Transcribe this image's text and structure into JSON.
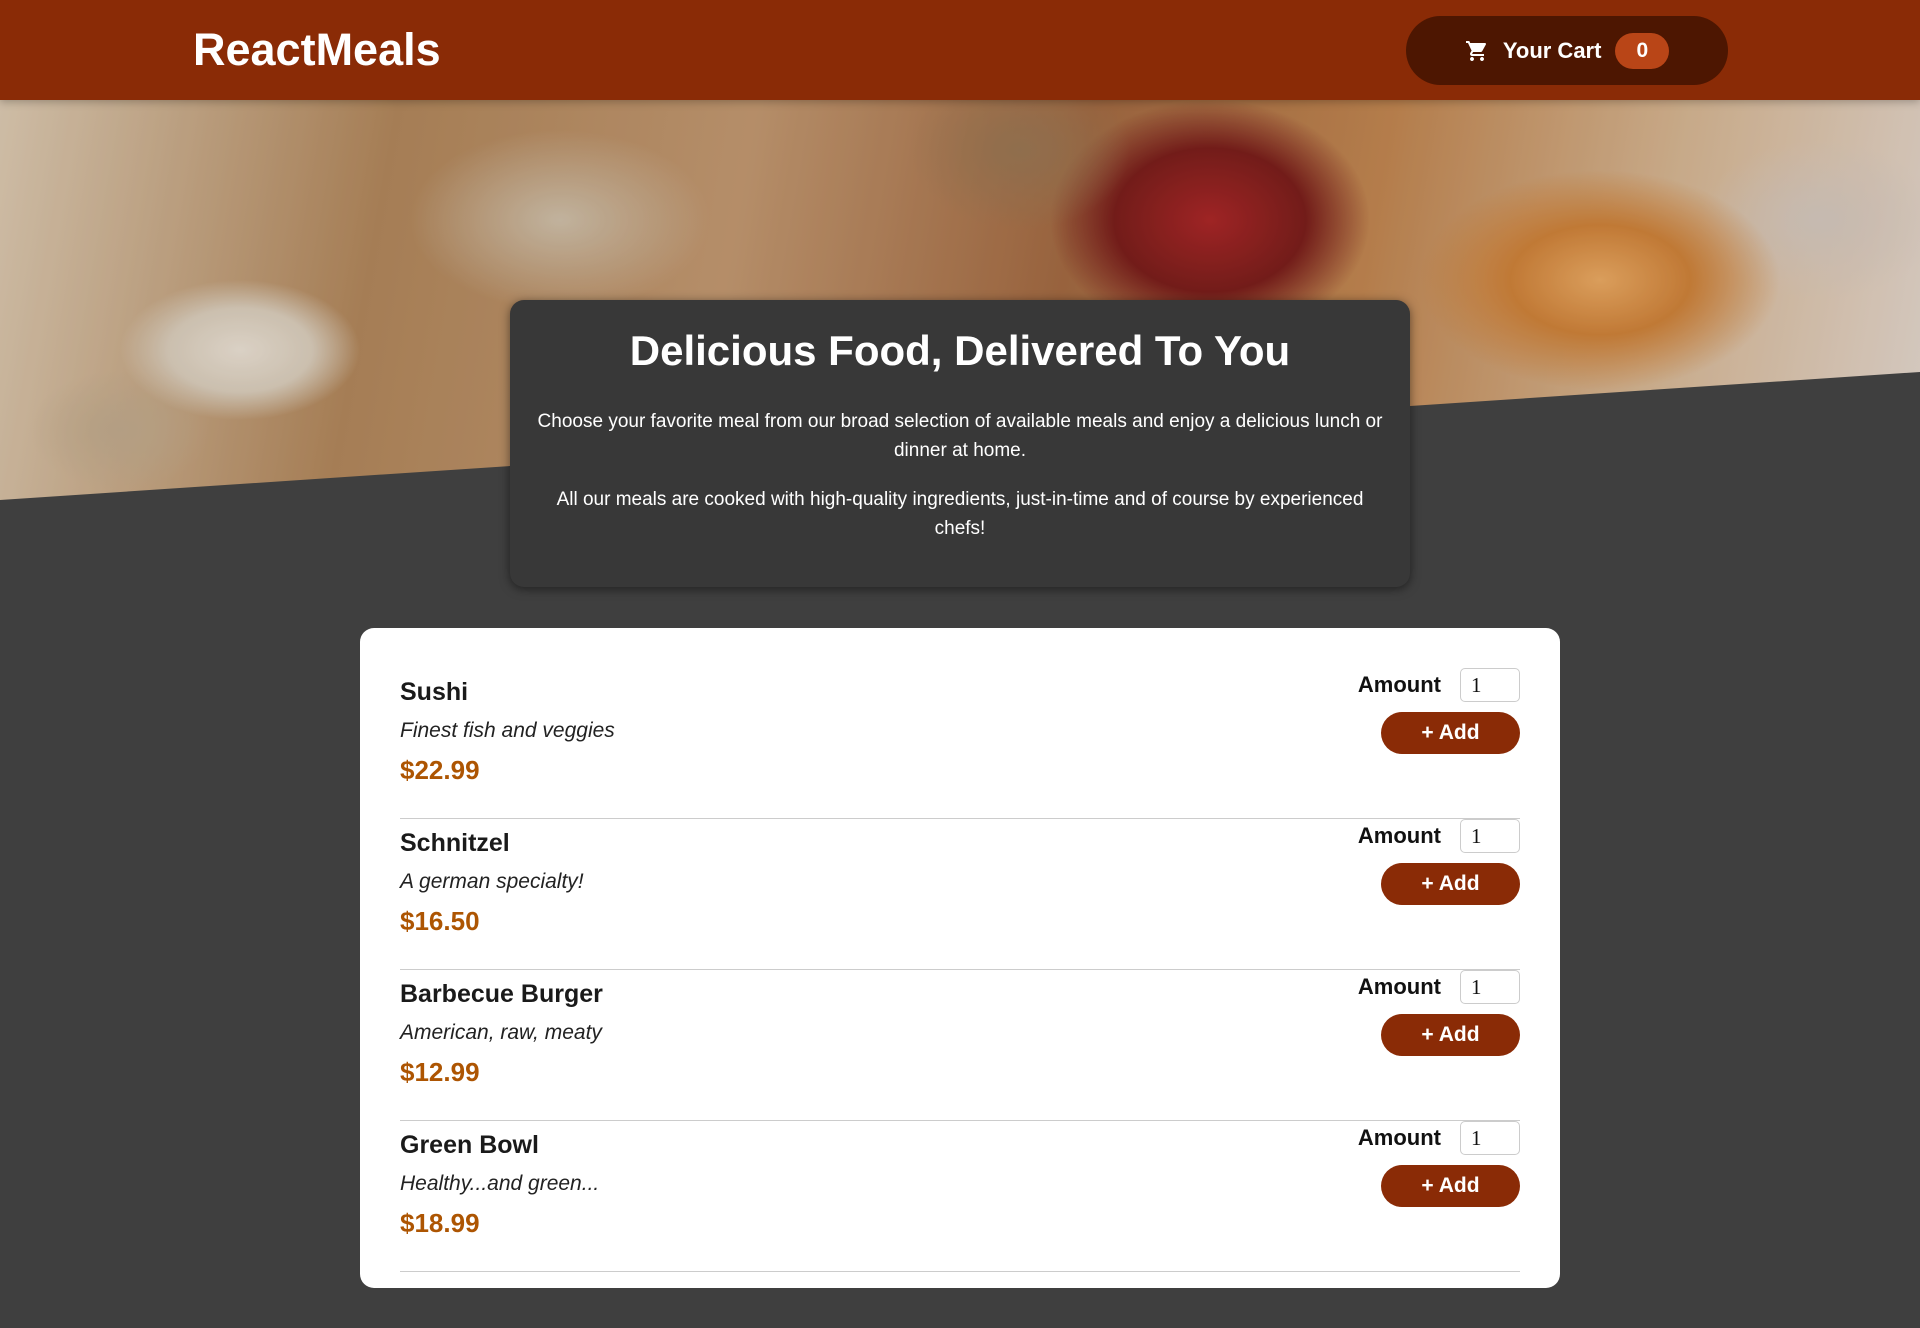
{
  "header": {
    "logo": "ReactMeals",
    "cart_label": "Your Cart",
    "cart_count": "0",
    "cart_icon": "shopping-cart-icon"
  },
  "summary": {
    "title": "Delicious Food, Delivered To You",
    "p1": "Choose your favorite meal from our broad selection of available meals and enjoy a delicious lunch or dinner at home.",
    "p2": "All our meals are cooked with high-quality ingredients, just-in-time and of course by experienced chefs!"
  },
  "meals": [
    {
      "name": "Sushi",
      "description": "Finest fish and veggies",
      "price": "$22.99",
      "amount_label": "Amount",
      "amount_value": "1",
      "add_label": "+ Add"
    },
    {
      "name": "Schnitzel",
      "description": "A german specialty!",
      "price": "$16.50",
      "amount_label": "Amount",
      "amount_value": "1",
      "add_label": "+ Add"
    },
    {
      "name": "Barbecue Burger",
      "description": "American, raw, meaty",
      "price": "$12.99",
      "amount_label": "Amount",
      "amount_value": "1",
      "add_label": "+ Add"
    },
    {
      "name": "Green Bowl",
      "description": "Healthy...and green...",
      "price": "$18.99",
      "amount_label": "Amount",
      "amount_value": "1",
      "add_label": "+ Add"
    }
  ],
  "colors": {
    "header": "#8a2b06",
    "cart_button": "#4d1601",
    "badge": "#b94517",
    "background": "#3f3f3f",
    "summary_card": "#383838",
    "price": "#ad5502"
  }
}
